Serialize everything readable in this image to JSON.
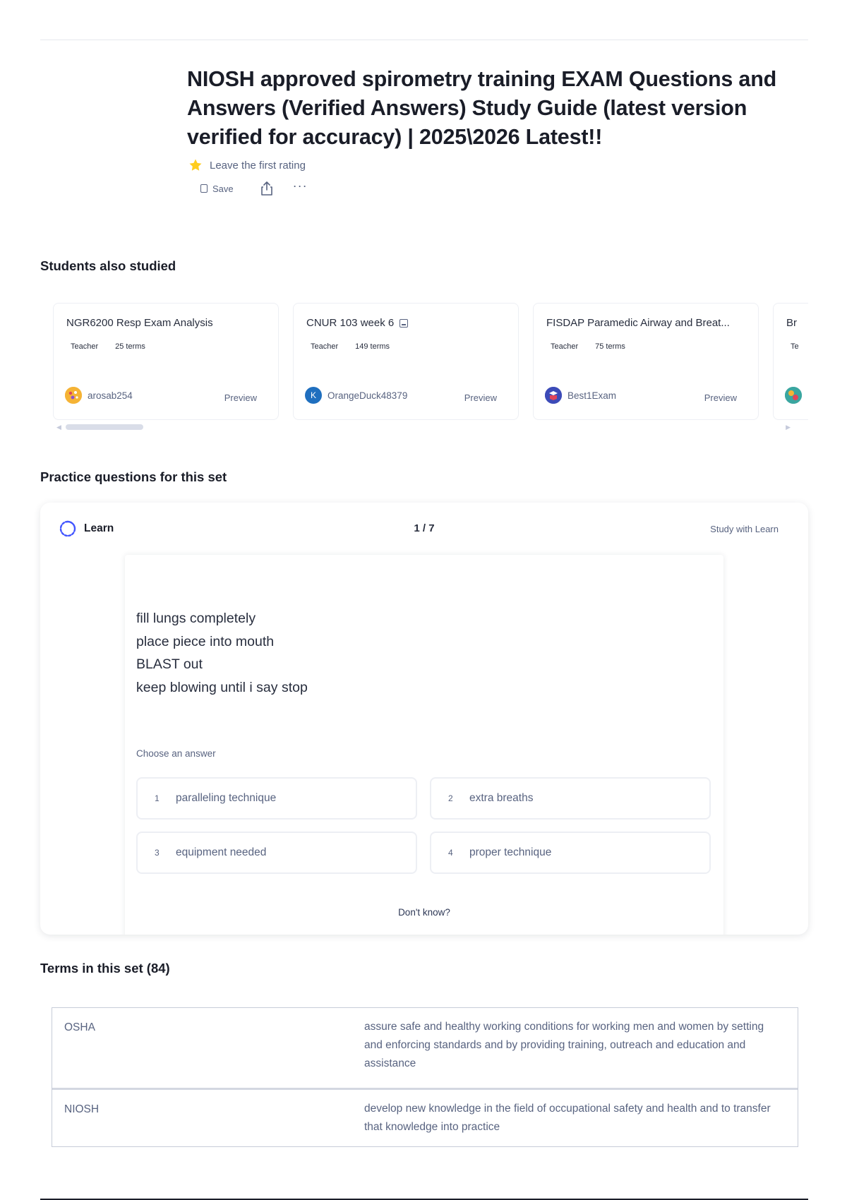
{
  "set": {
    "title": "NIOSH approved spirometry training EXAM Questions and Answers (Verified Answers) Study Guide (latest version verified for accuracy) | 2025\\2026 Latest!!",
    "rating_text": "Leave the first rating",
    "save_label": "Save",
    "more_label": "···"
  },
  "students_also_studied": {
    "heading": "Students also studied",
    "cards": [
      {
        "title": "NGR6200 Resp Exam Analysis",
        "role": "Teacher",
        "terms": "25 terms",
        "user": "arosab254",
        "preview": "Preview",
        "avatar_color": "#f5b335",
        "avatar_letter": ""
      },
      {
        "title": "CNUR 103 week 6",
        "role": "Teacher",
        "terms": "149 terms",
        "user": "OrangeDuck48379",
        "preview": "Preview",
        "avatar_color": "#1f6fbf",
        "avatar_letter": "K"
      },
      {
        "title": "FISDAP Paramedic Airway and Breat...",
        "role": "Teacher",
        "terms": "75 terms",
        "user": "Best1Exam",
        "preview": "Preview",
        "avatar_color": "#3c4bb8",
        "avatar_letter": ""
      },
      {
        "title": "Br",
        "role": "Te",
        "terms": "",
        "user": "",
        "preview": "",
        "avatar_color": "#3aa6a0",
        "avatar_letter": ""
      }
    ]
  },
  "practice": {
    "heading": "Practice questions for this set",
    "mode_label": "Learn",
    "progress": "1 / 7",
    "study_link": "Study with Learn",
    "question_lines": [
      "fill lungs completely",
      "place piece into mouth",
      "BLAST out",
      "keep blowing until i say stop"
    ],
    "choose_label": "Choose an answer",
    "answers": [
      {
        "num": "1",
        "text": "paralleling technique"
      },
      {
        "num": "2",
        "text": "extra breaths"
      },
      {
        "num": "3",
        "text": "equipment needed"
      },
      {
        "num": "4",
        "text": "proper technique"
      }
    ],
    "dont_know": "Don't know?"
  },
  "terms": {
    "heading": "Terms in this set (84)",
    "rows": [
      {
        "term": "OSHA",
        "definition": "assure safe and healthy working conditions for working men and women by setting and enforcing standards and by providing training, outreach and education and assistance"
      },
      {
        "term": "NIOSH",
        "definition": "develop new knowledge in the field of occupational safety and health and to transfer that knowledge into practice"
      }
    ]
  },
  "colors": {
    "accent": "#4255ff",
    "star": "#ffcd1f",
    "text_primary": "#1a1d28",
    "text_secondary": "#586380"
  },
  "icons": [
    "star-icon",
    "bookmark-icon",
    "share-icon",
    "more-icon",
    "clip-icon",
    "learn-icon"
  ]
}
